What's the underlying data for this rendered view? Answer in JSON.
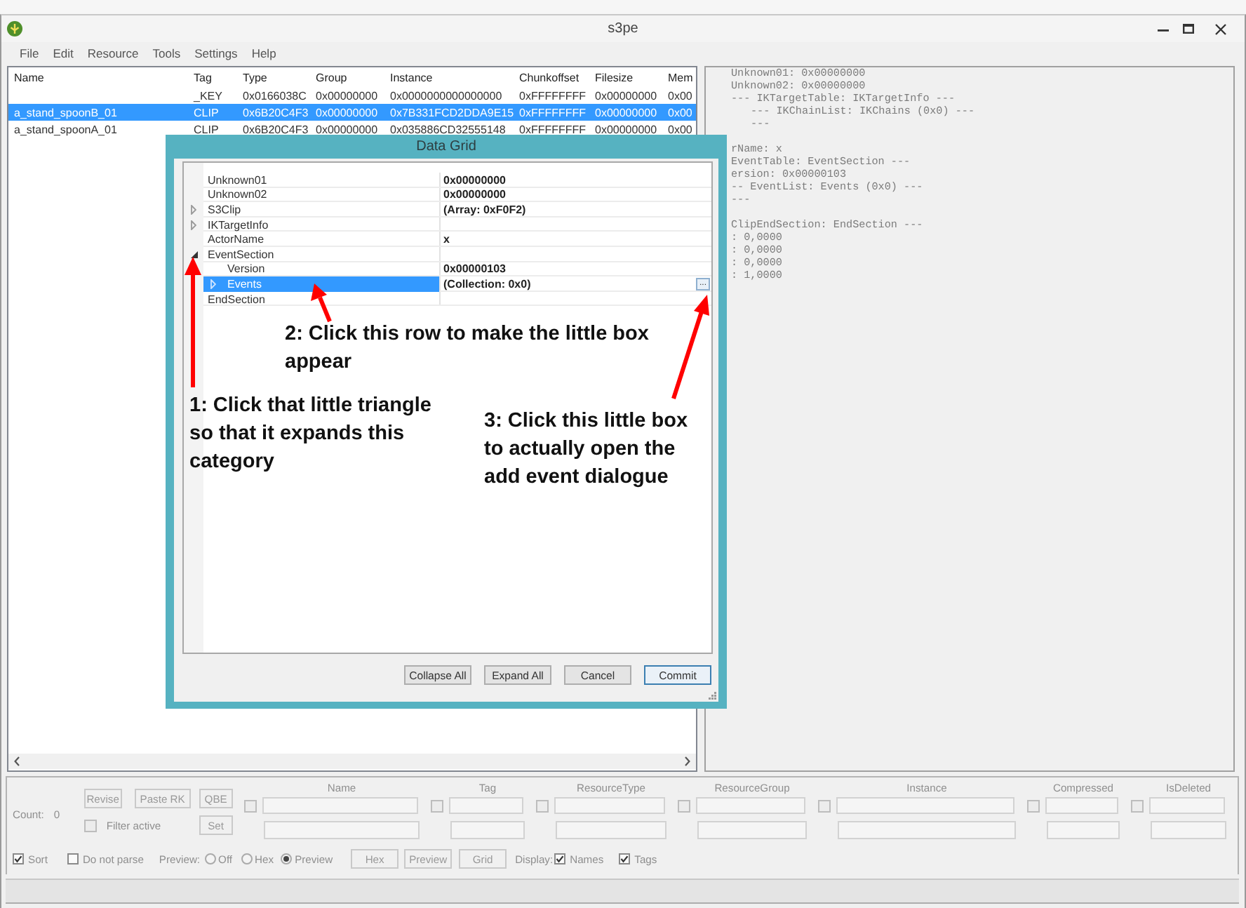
{
  "window": {
    "title": "s3pe"
  },
  "menu": [
    "File",
    "Edit",
    "Resource",
    "Tools",
    "Settings",
    "Help"
  ],
  "resource_list": {
    "columns": [
      "Name",
      "Tag",
      "Type",
      "Group",
      "Instance",
      "Chunkoffset",
      "Filesize",
      "Mem"
    ],
    "rows": [
      {
        "selected": false,
        "tag": "_KEY",
        "type": "0x0166038C",
        "group": "0x00000000",
        "instance": "0x0000000000000000",
        "chunkoffset": "0xFFFFFFFF",
        "filesize": "0x00000000",
        "mem": "0x00"
      },
      {
        "selected": true,
        "name": "a_stand_spoonB_01",
        "tag": "CLIP",
        "type": "0x6B20C4F3",
        "group": "0x00000000",
        "instance": "0x7B331FCD2DDA9E15",
        "chunkoffset": "0xFFFFFFFF",
        "filesize": "0x00000000",
        "mem": "0x00"
      },
      {
        "selected": false,
        "name": "a_stand_spoonA_01",
        "tag": "CLIP",
        "type": "0x6B20C4F3",
        "group": "0x00000000",
        "instance": "0x035886CD32555148",
        "chunkoffset": "0xFFFFFFFF",
        "filesize": "0x00000000",
        "mem": "0x00"
      }
    ]
  },
  "preview_text": {
    "blocks": [
      {
        "lines": [
          {
            "text": "Unknown01: 0x00000000"
          },
          {
            "text": "Unknown02: 0x00000000"
          },
          {
            "text": "--- IKTargetTable: IKTargetInfo ---",
            "children": [
              {
                "text": "--- IKChainList: IKChains (0x0) ---"
              },
              {
                "text": "---"
              }
            ]
          }
        ]
      },
      {
        "lines": [
          {
            "text": "rName: x"
          },
          {
            "text": "EventTable: EventSection ---"
          },
          {
            "text": "ersion: 0x00000103"
          },
          {
            "text": "-- EventList: Events (0x0) ---"
          },
          {
            "text": "---"
          }
        ]
      },
      {
        "lines": [
          {
            "text": "ClipEndSection: EndSection ---"
          },
          {
            "text": ": 0,0000"
          },
          {
            "text": ": 0,0000"
          },
          {
            "text": ": 0,0000"
          },
          {
            "text": ": 1,0000"
          }
        ]
      }
    ]
  },
  "dialog": {
    "title": "Data Grid",
    "rows": [
      {
        "name": "Unknown01",
        "value": "0x00000000",
        "selected": false
      },
      {
        "name": "Unknown02",
        "value": "0x00000000",
        "selected": false
      },
      {
        "name": "S3Clip",
        "value": "(Array: 0xF0F2)",
        "expanded": false,
        "selected": false
      },
      {
        "name": "IKTargetInfo",
        "expanded": false,
        "selected": false
      },
      {
        "name": "ActorName",
        "value": "x",
        "selected": false
      },
      {
        "name": "EventSection",
        "expanded": true,
        "selected": false,
        "children": [
          {
            "name": "Version",
            "value": "0x00000103",
            "selected": false
          },
          {
            "name": "Events",
            "value": "(Collection: 0x0)",
            "expanded": false,
            "selected": true,
            "action": "..."
          }
        ]
      },
      {
        "name": "EndSection",
        "selected": false
      }
    ],
    "buttons": [
      {
        "label": "Collapse All",
        "default": false
      },
      {
        "label": "Expand All",
        "default": false
      },
      {
        "label": "Cancel",
        "default": false
      },
      {
        "label": "Commit",
        "default": true
      }
    ]
  },
  "annotations": [
    "2: Click this row to make the little box appear",
    "1: Click that little triangle so that it expands this category",
    "3: Click this little box to actually open the add event dialogue"
  ],
  "filter_panel": {
    "count_label": "Count:",
    "count": "0",
    "buttons": [
      "Revise",
      "Paste RK",
      "QBE"
    ],
    "filter_active": {
      "label": "Filter active",
      "checked": false
    },
    "set_button": "Set",
    "fields": [
      {
        "label": "Name",
        "checked": false
      },
      {
        "label": "Tag",
        "checked": false
      },
      {
        "label": "ResourceType",
        "checked": false
      },
      {
        "label": "ResourceGroup",
        "checked": false
      },
      {
        "label": "Instance",
        "checked": false
      },
      {
        "label": "Compressed",
        "checked": false
      },
      {
        "label": "IsDeleted",
        "checked": false
      }
    ]
  },
  "options": {
    "sort": {
      "label": "Sort",
      "checked": true
    },
    "do_not_parse": {
      "label": "Do not parse",
      "checked": false
    },
    "preview_label": "Preview:",
    "preview_modes": [
      {
        "label": "Off",
        "selected": false
      },
      {
        "label": "Hex",
        "selected": false
      },
      {
        "label": "Preview",
        "selected": true
      }
    ],
    "view_buttons": [
      "Hex",
      "Preview",
      "Grid"
    ],
    "display_label": "Display:",
    "display": [
      {
        "label": "Names",
        "checked": true
      },
      {
        "label": "Tags",
        "checked": true
      }
    ]
  }
}
